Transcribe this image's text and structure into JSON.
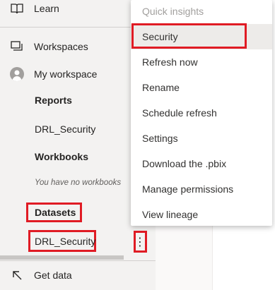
{
  "sidebar": {
    "learn": {
      "label": "Learn",
      "icon": "book-icon"
    },
    "workspaces": {
      "label": "Workspaces",
      "icon": "workspaces-icon"
    },
    "my_workspace": {
      "label": "My workspace",
      "icon": "avatar-icon"
    },
    "reports_header": "Reports",
    "report_item": "DRL_Security",
    "workbooks_header": "Workbooks",
    "workbooks_empty": "You have no workbooks",
    "datasets_header": "Datasets",
    "dataset_item": "DRL_Security",
    "more_options": "⋮",
    "get_data": {
      "label": "Get data",
      "icon": "arrow-up-left-icon"
    }
  },
  "context_menu": {
    "items": [
      {
        "label": "Quick insights",
        "state": "disabled"
      },
      {
        "label": "Security",
        "state": "highlighted"
      },
      {
        "label": "Refresh now",
        "state": "normal"
      },
      {
        "label": "Rename",
        "state": "normal"
      },
      {
        "label": "Schedule refresh",
        "state": "normal"
      },
      {
        "label": "Settings",
        "state": "normal"
      },
      {
        "label": "Download the .pbix",
        "state": "normal"
      },
      {
        "label": "Manage permissions",
        "state": "normal"
      },
      {
        "label": "View lineage",
        "state": "normal"
      }
    ]
  },
  "colors": {
    "sidebar_bg": "#f3f2f1",
    "highlight_box": "#e01b24",
    "menu_hover": "#edebe9"
  }
}
